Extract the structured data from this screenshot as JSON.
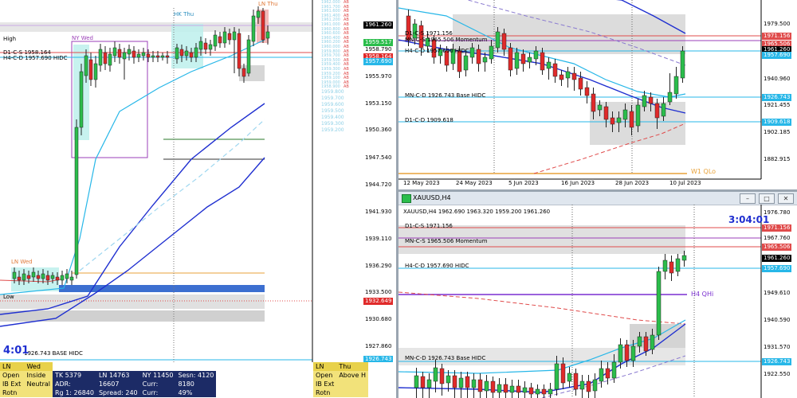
{
  "left_chart": {
    "labels": {
      "ln_thu": "LN Thu",
      "hk_thu": "HK Thu",
      "ny_wed": "NY Wed",
      "high": "High",
      "d1_cs": "D1-C-S 1958.164",
      "h4_cd": "H4-C-D 1957.690 HIDC",
      "ln_wed": "LN Wed",
      "low": "Low",
      "base": "1926.743 BASE HIDC",
      "timer": "4:01"
    },
    "price_axis": [
      "1961.260",
      "1959.517",
      "1958.790",
      "1955.970",
      "1953.150",
      "1950.360",
      "1947.540",
      "1944.720",
      "1941.930",
      "1939.110",
      "1936.290",
      "1933.500",
      "1932.649",
      "1930.680",
      "1927.860",
      "1926.743"
    ],
    "ab_list": [
      {
        "v": "1962.000",
        "l": "AB"
      },
      {
        "v": "1961.700",
        "l": "AB"
      },
      {
        "v": "1961.600",
        "l": "AB"
      },
      {
        "v": "1961.400",
        "l": "AB"
      },
      {
        "v": "1961.200",
        "l": "AB"
      },
      {
        "v": "1961.000",
        "l": "AB"
      },
      {
        "v": "1960.800",
        "l": "AB"
      },
      {
        "v": "1960.600",
        "l": "AB"
      },
      {
        "v": "1960.400",
        "l": "AB"
      },
      {
        "v": "1960.200",
        "l": "AB"
      },
      {
        "v": "1960.000",
        "l": "AB"
      },
      {
        "v": "1959.800",
        "l": "AB"
      },
      {
        "v": "1959.700",
        "l": "AB"
      },
      {
        "v": "1959.500",
        "l": "AB"
      },
      {
        "v": "1959.400",
        "l": "AB"
      },
      {
        "v": "1959.300",
        "l": "AB"
      },
      {
        "v": "1959.200",
        "l": "AB"
      },
      {
        "v": "1959.100",
        "l": "AB"
      },
      {
        "v": "1959.000",
        "l": "AB"
      },
      {
        "v": "1958.900",
        "l": "AB"
      }
    ],
    "ab_list2": [
      "1959.800",
      "1959.700",
      "1959.600",
      "1959.500",
      "1959.400",
      "1959.300",
      "1959.200"
    ]
  },
  "info_panel": {
    "left": {
      "session": "LN",
      "day": "Wed",
      "rows": [
        [
          "Open",
          "Inside"
        ],
        [
          "IB Ext",
          "Neutral"
        ],
        [
          "Rotn",
          ""
        ]
      ]
    },
    "stats": {
      "row1": [
        "TK 5379",
        "LN 14763",
        "NY 11450",
        "Sesn: 4120"
      ],
      "row2": [
        "ADR:",
        "16607",
        "Curr:",
        "8180"
      ],
      "row3": [
        "Rg 1: 26840",
        "Spread: 240",
        "Curr:",
        "49%"
      ]
    },
    "right": {
      "session": "LN",
      "day": "Thu",
      "rows": [
        [
          "Open",
          "Above H"
        ],
        [
          "IB Ext",
          ""
        ],
        [
          "Rotn",
          ""
        ]
      ]
    }
  },
  "top_right_chart": {
    "labels": {
      "d1_cs": "D1-C-S 1971.156",
      "mn_cs": "MN-C-S 1965.506 Momentum",
      "h4_cd": "H4-C-D 1957.690 HIDC",
      "mn_cd": "MN-C-D 1926.743 Base HIDC",
      "d1_cd": "D1-C-D 1909.618",
      "w1_qlo": "W1 QLo"
    },
    "price_axis": [
      "1979.500",
      "1971.156",
      "1965.506",
      "1961.260",
      "1957.690",
      "1940.960",
      "1926.743",
      "1921.455",
      "1909.618",
      "1902.185",
      "1882.915"
    ],
    "dates": [
      "12 May 2023",
      "24 May 2023",
      "5 Jun 2023",
      "16 Jun 2023",
      "28 Jun 2023",
      "10 Jul 2023"
    ]
  },
  "bottom_right_chart": {
    "title": "XAUUSD,H4",
    "ohlc": "XAUUSD,H4  1962.690 1963.320 1959.200 1961.260",
    "timer": "3:04:01",
    "labels": {
      "d1_cs": "D1-C-S 1971.156",
      "mn_cs": "MN-C-S 1965.506 Momentum",
      "h4_cd": "H4-C-D 1957.690 HIDC",
      "h4_qhi": "H4 QHi",
      "mn_cd": "MN-C-D 1926.743 Base HIDC"
    },
    "price_axis": [
      "1976.780",
      "1971.156",
      "1967.760",
      "1965.506",
      "1961.260",
      "1957.690",
      "1949.610",
      "1940.590",
      "1931.570",
      "1926.743",
      "1922.550"
    ]
  },
  "colors": {
    "bull": "#2bbd4b",
    "bear": "#e02a2a",
    "ma_blue": "#1f2fd0",
    "ma_cyan": "#27b7e8",
    "red_line": "#e04b4b",
    "purple": "#7a2fd0",
    "gray_zone": "#d4d4d4"
  }
}
